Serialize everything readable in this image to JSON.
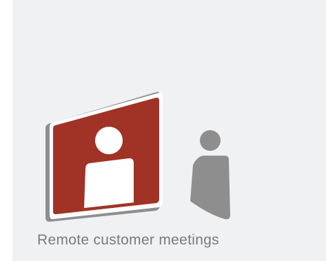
{
  "card": {
    "caption": "Remote customer meetings",
    "icon": "video-meeting-icon"
  },
  "colors": {
    "card_background": "#f0f1f3",
    "screen_fill": "#a03325",
    "frame_gray": "#8e8e8e",
    "person_gray": "#8e8e8e",
    "caption_text": "#7a7a7a"
  }
}
